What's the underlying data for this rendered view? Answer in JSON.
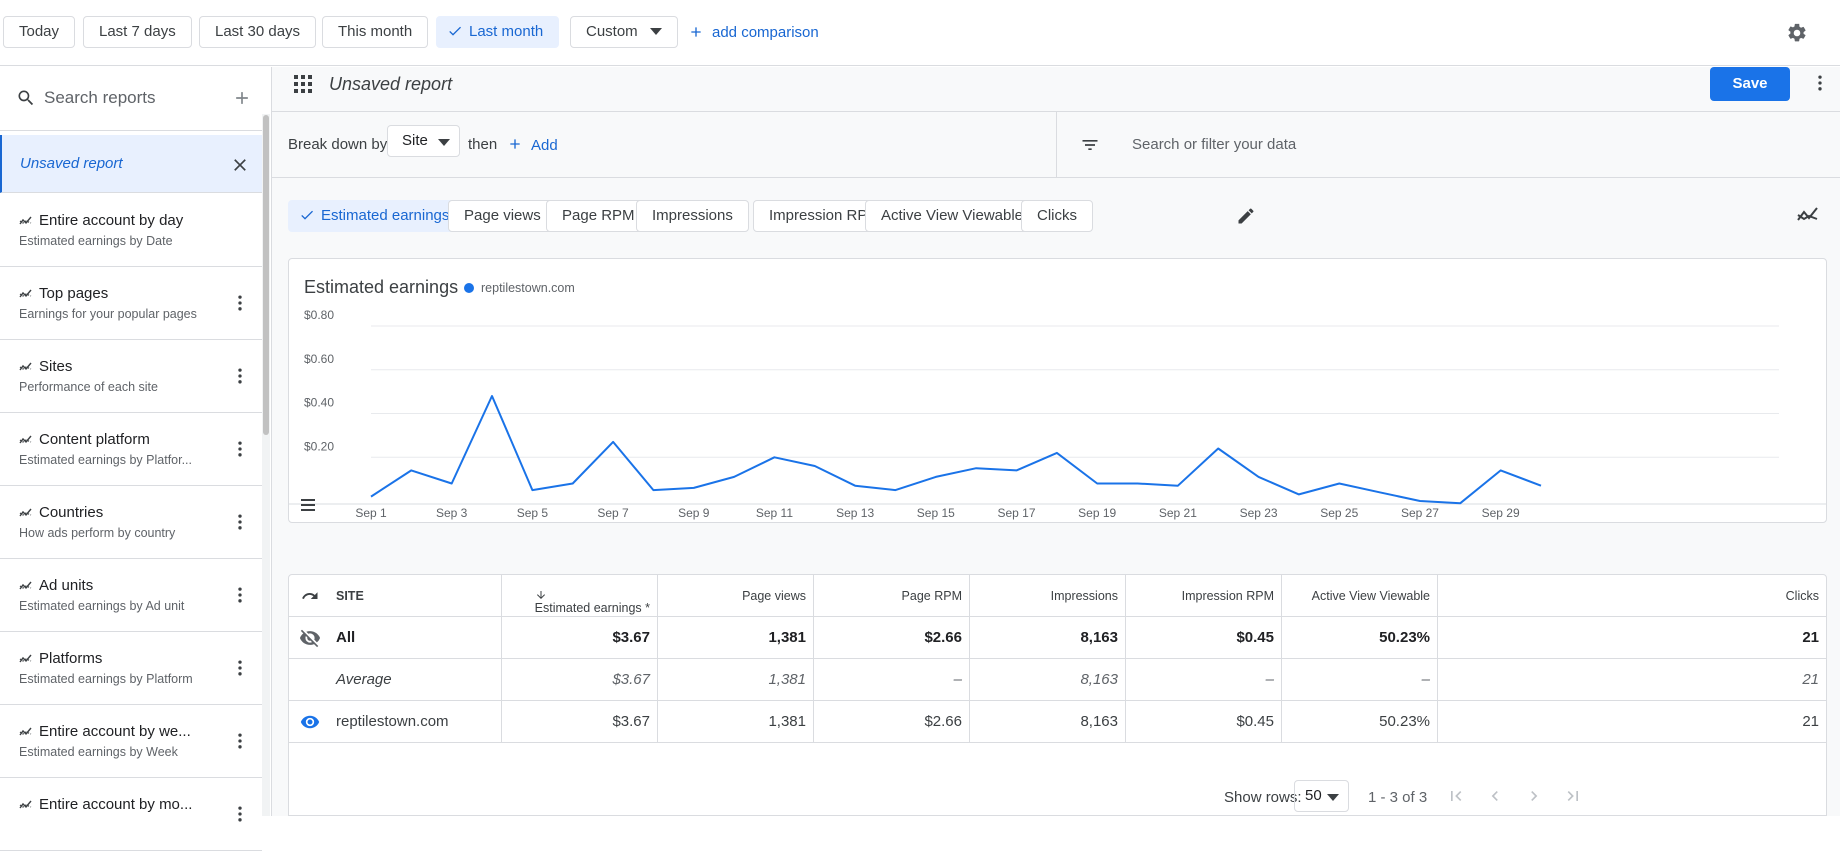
{
  "date_range": {
    "options": [
      "Today",
      "Last 7 days",
      "Last 30 days",
      "This month",
      "Last month"
    ],
    "selected": "Last month",
    "custom_label": "Custom",
    "add_comparison": "add comparison"
  },
  "sidebar": {
    "search_placeholder": "Search reports",
    "unsaved_label": "Unsaved report",
    "items": [
      {
        "title": "Entire account by day",
        "subtitle": "Estimated earnings by Date"
      },
      {
        "title": "Top pages",
        "subtitle": "Earnings for your popular pages"
      },
      {
        "title": "Sites",
        "subtitle": "Performance of each site"
      },
      {
        "title": "Content platform",
        "subtitle": "Estimated earnings by Platfor..."
      },
      {
        "title": "Countries",
        "subtitle": "How ads perform by country"
      },
      {
        "title": "Ad units",
        "subtitle": "Estimated earnings by Ad unit"
      },
      {
        "title": "Platforms",
        "subtitle": "Estimated earnings by Platform"
      },
      {
        "title": "Entire account by we...",
        "subtitle": "Estimated earnings by Week"
      },
      {
        "title": "Entire account by mo...",
        "subtitle": ""
      }
    ]
  },
  "report": {
    "title": "Unsaved report",
    "save_label": "Save",
    "breakdown_label": "Break down by",
    "breakdown_value": "Site",
    "then_label": "then",
    "add_label": "Add",
    "filter_placeholder": "Search or filter your data"
  },
  "metrics": {
    "chips": [
      "Estimated earnings",
      "Page views",
      "Page RPM",
      "Impressions",
      "Impression RPM",
      "Active View Viewable",
      "Clicks"
    ],
    "selected": "Estimated earnings"
  },
  "chart_data": {
    "type": "line",
    "title": "Estimated earnings",
    "series": [
      {
        "name": "reptilestown.com",
        "color": "#1a73e8",
        "values": [
          0.02,
          0.14,
          0.08,
          0.48,
          0.05,
          0.08,
          0.27,
          0.05,
          0.06,
          0.11,
          0.2,
          0.16,
          0.07,
          0.05,
          0.11,
          0.15,
          0.14,
          0.22,
          0.08,
          0.08,
          0.07,
          0.24,
          0.11,
          0.03,
          0.08,
          0.04,
          0.0,
          -0.01,
          0.14,
          0.07
        ]
      }
    ],
    "x": [
      "Sep 1",
      "Sep 2",
      "Sep 3",
      "Sep 4",
      "Sep 5",
      "Sep 6",
      "Sep 7",
      "Sep 8",
      "Sep 9",
      "Sep 10",
      "Sep 11",
      "Sep 12",
      "Sep 13",
      "Sep 14",
      "Sep 15",
      "Sep 16",
      "Sep 17",
      "Sep 18",
      "Sep 19",
      "Sep 20",
      "Sep 21",
      "Sep 22",
      "Sep 23",
      "Sep 24",
      "Sep 25",
      "Sep 26",
      "Sep 27",
      "Sep 28",
      "Sep 29",
      "Sep 30"
    ],
    "x_tick_labels": [
      "Sep 1",
      "Sep 3",
      "Sep 5",
      "Sep 7",
      "Sep 9",
      "Sep 11",
      "Sep 13",
      "Sep 15",
      "Sep 17",
      "Sep 19",
      "Sep 21",
      "Sep 23",
      "Sep 25",
      "Sep 27",
      "Sep 29"
    ],
    "y_ticks": [
      0.2,
      0.4,
      0.6,
      0.8
    ],
    "y_tick_labels": [
      "$0.20",
      "$0.40",
      "$0.60",
      "$0.80"
    ],
    "ylim": [
      0,
      0.8
    ],
    "grid": true,
    "legend_position": "top-left"
  },
  "table": {
    "columns": [
      "SITE",
      "Estimated earnings *",
      "Page views",
      "Page RPM",
      "Impressions",
      "Impression RPM",
      "Active View Viewable",
      "Clicks"
    ],
    "rows": [
      {
        "label": "All",
        "values": [
          "$3.67",
          "1,381",
          "$2.66",
          "8,163",
          "$0.45",
          "50.23%",
          "21"
        ]
      },
      {
        "label": "Average",
        "values": [
          "$3.67",
          "1,381",
          "–",
          "8,163",
          "–",
          "–",
          "21"
        ]
      },
      {
        "label": "reptilestown.com",
        "values": [
          "$3.67",
          "1,381",
          "$2.66",
          "8,163",
          "$0.45",
          "50.23%",
          "21"
        ]
      }
    ],
    "show_rows_label": "Show rows:",
    "rows_per_page": "50",
    "range_label": "1 - 3 of 3"
  },
  "colors": {
    "accent": "#1a73e8",
    "chip_selected_bg": "#e8f0fe",
    "chip_selected_text": "#1967d2",
    "series": "#1a73e8"
  }
}
